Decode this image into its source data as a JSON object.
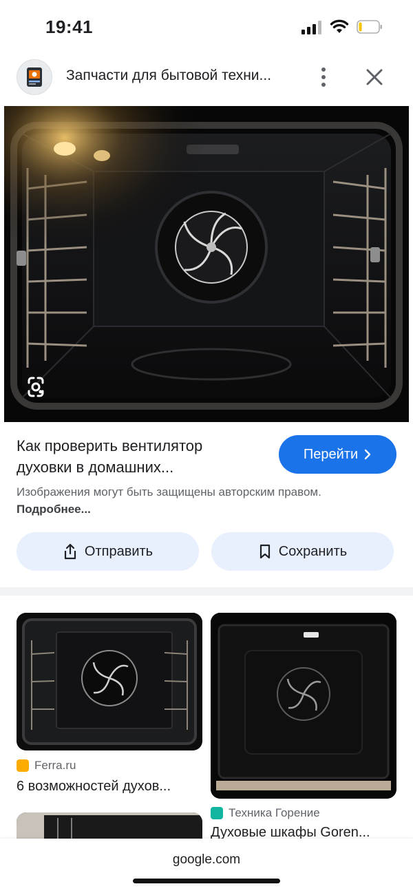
{
  "status_bar": {
    "time": "19:41",
    "battery_level": 0.15
  },
  "header": {
    "site_title": "Запчасти для бытовой техни..."
  },
  "result": {
    "title": "Как проверить вентилятор духовки в домашних...",
    "go_label": "Перейти",
    "copyright_text": "Изображения могут быть защищены авторским правом.",
    "more_link": "Подробнее..."
  },
  "actions": {
    "share_label": "Отправить",
    "save_label": "Сохранить"
  },
  "related": [
    {
      "source": "Ferra.ru",
      "title": "6 возможностей духов..."
    },
    {
      "source": "Техника Горение",
      "title": "Духовые шкафы Goren..."
    }
  ],
  "browser": {
    "url": "google.com"
  },
  "colors": {
    "accent": "#1a73e8",
    "pill": "#e8f0fe",
    "ferra_icon": "#f9ab00",
    "gorenje_icon": "#12b5a0"
  }
}
